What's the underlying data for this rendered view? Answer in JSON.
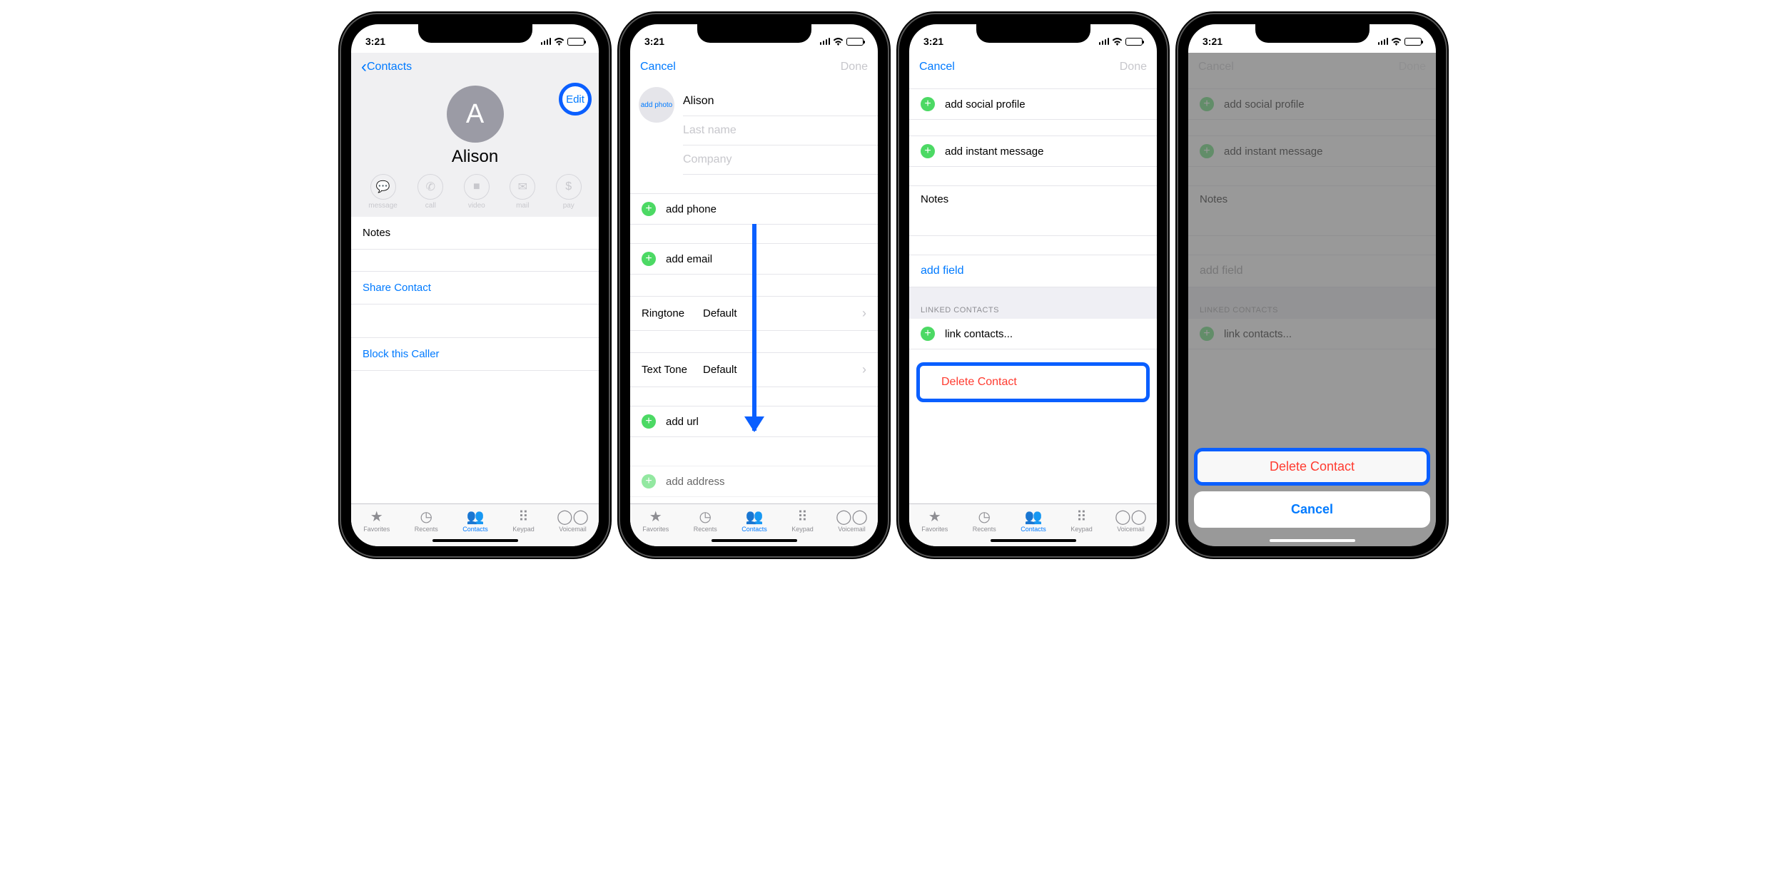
{
  "status": {
    "time": "3:21",
    "loc_icon": "location"
  },
  "s1": {
    "back": "Contacts",
    "edit": "Edit",
    "avatar_initial": "A",
    "name": "Alison",
    "actions": [
      {
        "label": "message",
        "icon": "speech"
      },
      {
        "label": "call",
        "icon": "phone"
      },
      {
        "label": "video",
        "icon": "video"
      },
      {
        "label": "mail",
        "icon": "mail"
      },
      {
        "label": "pay",
        "icon": "dollar"
      }
    ],
    "notes": "Notes",
    "share": "Share Contact",
    "block": "Block this Caller"
  },
  "s2": {
    "cancel": "Cancel",
    "done": "Done",
    "add_photo": "add photo",
    "first_name": "Alison",
    "last_name_ph": "Last name",
    "company_ph": "Company",
    "add_phone": "add phone",
    "add_email": "add email",
    "ringtone_label": "Ringtone",
    "ringtone_value": "Default",
    "texttone_label": "Text Tone",
    "texttone_value": "Default",
    "add_url": "add url",
    "add_address": "add address"
  },
  "s3": {
    "cancel": "Cancel",
    "done": "Done",
    "add_social": "add social profile",
    "add_im": "add instant message",
    "notes": "Notes",
    "add_field": "add field",
    "linked_header": "LINKED CONTACTS",
    "link_contacts": "link contacts...",
    "delete": "Delete Contact"
  },
  "s4": {
    "cancel": "Cancel",
    "done": "Done",
    "add_social": "add social profile",
    "add_im": "add instant message",
    "notes": "Notes",
    "add_field": "add field",
    "linked_header": "LINKED CONTACTS",
    "link_contacts": "link contacts...",
    "sheet_delete": "Delete Contact",
    "sheet_cancel": "Cancel"
  },
  "tabs": [
    {
      "label": "Favorites",
      "icon": "star"
    },
    {
      "label": "Recents",
      "icon": "clock"
    },
    {
      "label": "Contacts",
      "icon": "people",
      "active": true
    },
    {
      "label": "Keypad",
      "icon": "keypad"
    },
    {
      "label": "Voicemail",
      "icon": "voicemail"
    }
  ]
}
